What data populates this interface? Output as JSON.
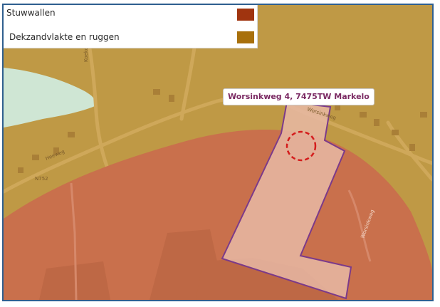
{
  "legend": {
    "items": [
      {
        "label": "Stuwwallen",
        "color": "#a0340f"
      },
      {
        "label": "Dekzandvlakte en ruggen",
        "color": "#a8700c"
      }
    ]
  },
  "callout": {
    "address": "Worsinkweg 4, 7475TW Markelo",
    "color": "#7b2a63"
  },
  "road_labels": {
    "r1": "Koekoeksweg",
    "r2": "Heeweg",
    "r3": "Worsinkweg",
    "r4": "N752",
    "r5": "Worsinkweg"
  },
  "colors": {
    "dekzand_fill": "#bf9945",
    "stuwwal_fill": "#c9704c",
    "stuwwal_inner": "#be6845",
    "water_fill": "#cfe6d4",
    "parcel_fill": "#e8b8a4",
    "parcel_stroke": "#7b3a8a",
    "marker": "#d41c1c"
  }
}
